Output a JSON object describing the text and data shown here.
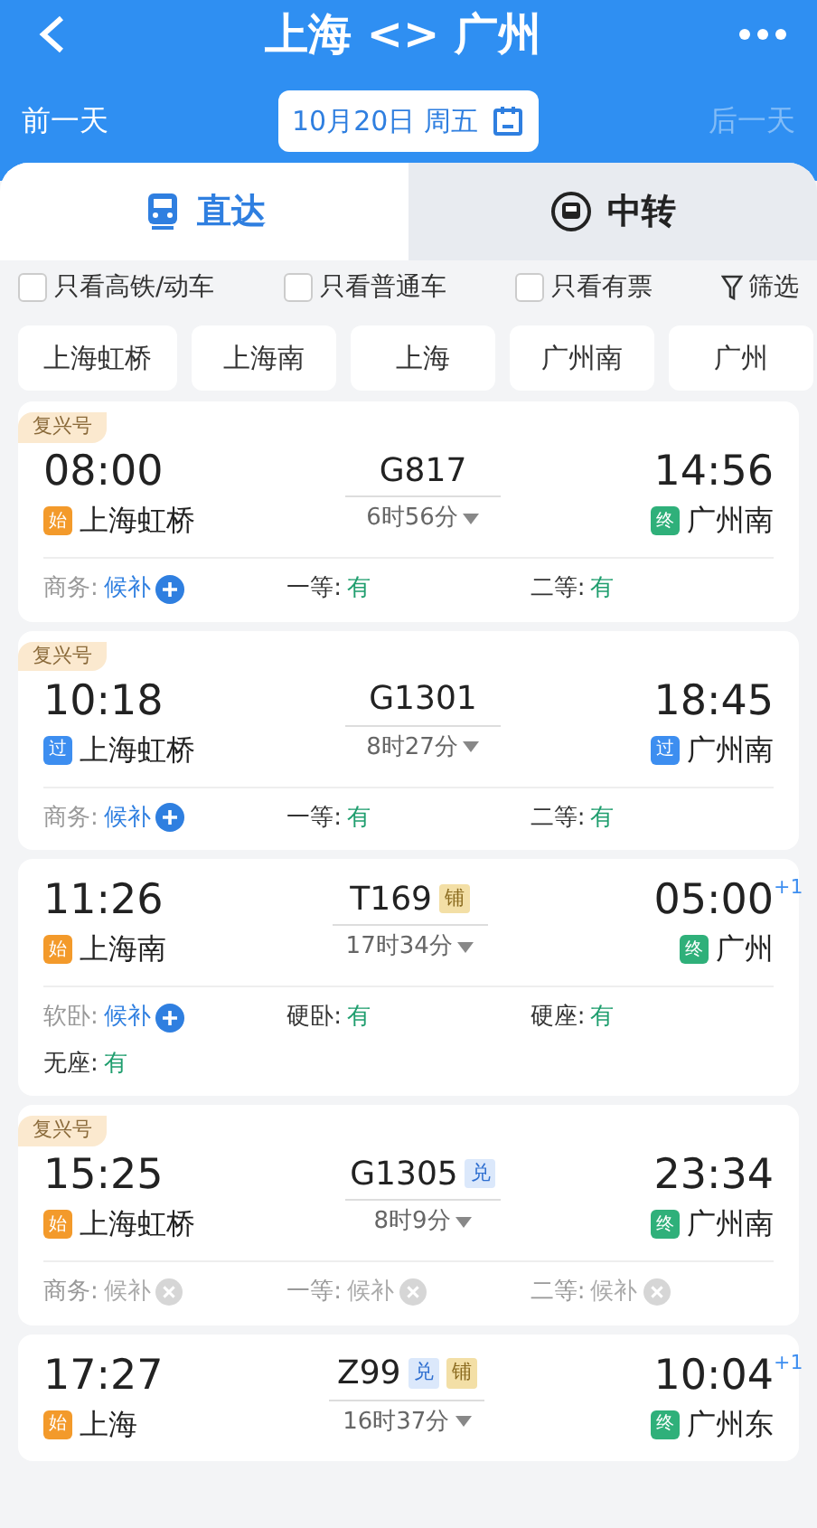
{
  "header": {
    "title": "上海 <> 广州"
  },
  "date_bar": {
    "prev": "前一天",
    "date": "10月20日 周五",
    "next": {
      "label": "后一天",
      "disabled": true
    }
  },
  "tabs": [
    {
      "label": "直达",
      "selected": true,
      "kind": "direct"
    },
    {
      "label": "中转",
      "selected": false,
      "kind": "transfer"
    }
  ],
  "filters": [
    {
      "label": "只看高铁/动车",
      "checked": false
    },
    {
      "label": "只看普通车",
      "checked": false
    },
    {
      "label": "只看有票",
      "checked": false
    }
  ],
  "filter_button": "筛选",
  "stations": [
    "上海虹桥",
    "上海南",
    "上海",
    "广州南",
    "广州"
  ],
  "trains": [
    {
      "badge": "复兴号",
      "depart": "08:00",
      "from": {
        "mark": "始",
        "kind": "start",
        "name": "上海虹桥"
      },
      "code": "G817",
      "duration": "6时56分",
      "arrive": "14:56",
      "to": {
        "mark": "终",
        "kind": "end",
        "name": "广州南"
      },
      "seats": [
        {
          "label": "商务:",
          "status": "候补",
          "kind": "waitlist"
        },
        {
          "label": "一等:",
          "status": "有",
          "kind": "available"
        },
        {
          "label": "二等:",
          "status": "有",
          "kind": "available"
        }
      ]
    },
    {
      "badge": "复兴号",
      "depart": "10:18",
      "from": {
        "mark": "过",
        "kind": "pass",
        "name": "上海虹桥"
      },
      "code": "G1301",
      "duration": "8时27分",
      "arrive": "18:45",
      "to": {
        "mark": "过",
        "kind": "pass",
        "name": "广州南"
      },
      "seats": [
        {
          "label": "商务:",
          "status": "候补",
          "kind": "waitlist"
        },
        {
          "label": "一等:",
          "status": "有",
          "kind": "available"
        },
        {
          "label": "二等:",
          "status": "有",
          "kind": "available"
        }
      ]
    },
    {
      "depart": "11:26",
      "from": {
        "mark": "始",
        "kind": "start",
        "name": "上海南"
      },
      "code": "T169",
      "tags": [
        {
          "text": "铺",
          "kind": "sleeper"
        }
      ],
      "duration": "17时34分",
      "arrive": "05:00",
      "day_offset": "+1",
      "to": {
        "mark": "终",
        "kind": "end",
        "name": "广州"
      },
      "seats": [
        {
          "label": "软卧:",
          "status": "候补",
          "kind": "waitlist"
        },
        {
          "label": "硬卧:",
          "status": "有",
          "kind": "available"
        },
        {
          "label": "硬座:",
          "status": "有",
          "kind": "available"
        },
        {
          "label": "无座:",
          "status": "有",
          "kind": "available"
        }
      ]
    },
    {
      "badge": "复兴号",
      "depart": "15:25",
      "from": {
        "mark": "始",
        "kind": "start",
        "name": "上海虹桥"
      },
      "code": "G1305",
      "tags": [
        {
          "text": "兑",
          "kind": "exchange"
        }
      ],
      "duration": "8时9分",
      "arrive": "23:34",
      "to": {
        "mark": "终",
        "kind": "end",
        "name": "广州南"
      },
      "seats": [
        {
          "label": "商务:",
          "status": "候补",
          "kind": "closed"
        },
        {
          "label": "一等:",
          "status": "候补",
          "kind": "closed"
        },
        {
          "label": "二等:",
          "status": "候补",
          "kind": "closed"
        }
      ]
    },
    {
      "depart": "17:27",
      "from": {
        "mark": "始",
        "kind": "start",
        "name": "上海"
      },
      "code": "Z99",
      "tags": [
        {
          "text": "兑",
          "kind": "exchange"
        },
        {
          "text": "铺",
          "kind": "sleeper"
        }
      ],
      "duration": "16时37分",
      "arrive": "10:04",
      "day_offset": "+1",
      "to": {
        "mark": "终",
        "kind": "end",
        "name": "广州东"
      }
    }
  ]
}
